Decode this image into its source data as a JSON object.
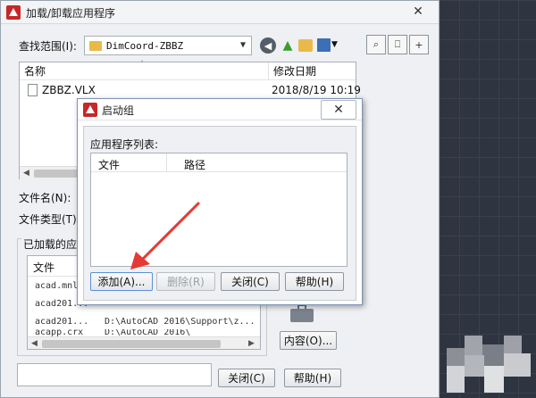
{
  "main_dialog": {
    "title": "加载/卸载应用程序",
    "lookin_label": "查找范围(I):",
    "folder": "DimCoord-ZBBZ",
    "toolbar_icons": [
      "back-icon",
      "up-folder-icon",
      "new-folder-icon",
      "views-menu-icon"
    ],
    "right_icons": [
      "find-icon",
      "locations-icon",
      "add-to-favorites-icon"
    ],
    "file_columns": {
      "name": "名称",
      "modified": "修改日期"
    },
    "files": [
      {
        "name": "ZBBZ.VLX",
        "modified": "2018/8/19 10:19"
      }
    ],
    "filename_label": "文件名(N):",
    "filetype_label": "文件类型(T):",
    "loaded_group_title": "已加载的应用",
    "loaded_column": "文件",
    "loaded_rows": [
      {
        "file": "acad.mnl",
        "path": ""
      },
      {
        "file": "acad201...",
        "path": ""
      },
      {
        "file": "acad201...",
        "path": "D:\\AutoCAD 2016\\Support\\z..."
      },
      {
        "file": "acapp.crx",
        "path": "D:\\AutoCAD 2016\\"
      }
    ],
    "contents_button": "内容(O)...",
    "close_button": "关闭(C)",
    "help_button": "帮助(H)"
  },
  "startup_dialog": {
    "title": "启动组",
    "list_label": "应用程序列表:",
    "columns": {
      "file": "文件",
      "path": "路径"
    },
    "add_button": "添加(A)...",
    "remove_button": "删除(R)",
    "close_button": "关闭(C)",
    "help_button": "帮助(H)"
  },
  "colors": {
    "autocad_red": "#c62828",
    "arrow_red": "#e53935",
    "canvas_dark": "#2e3440"
  }
}
